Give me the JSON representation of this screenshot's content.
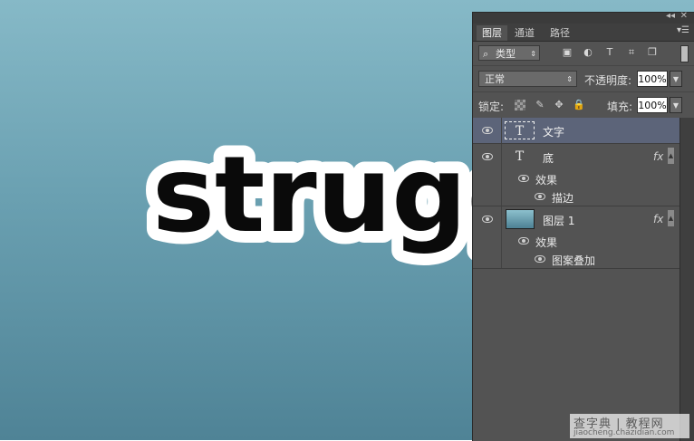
{
  "canvas": {
    "artwork_text": "struggl",
    "bg_top": "#86b9c7",
    "bg_bottom": "#4f8396"
  },
  "panel": {
    "tabs": [
      "图层",
      "通道",
      "路径"
    ],
    "active_tab": "图层",
    "filter_kind": "类型",
    "filter_icons": [
      "image-filter-icon",
      "adjustment-filter-icon",
      "type-filter-icon",
      "shape-filter-icon",
      "smart-object-filter-icon"
    ],
    "blend_mode": "正常",
    "opacity_label": "不透明度:",
    "opacity_value": "100%",
    "lock_label": "锁定:",
    "fill_label": "填充:",
    "fill_value": "100%",
    "layers": [
      {
        "name": "文字",
        "type": "text",
        "selected": true,
        "fx": ""
      },
      {
        "name": "底",
        "type": "text",
        "selected": false,
        "fx": "fx",
        "effects_label": "效果",
        "effects": [
          "描边"
        ]
      },
      {
        "name": "图层 1",
        "type": "image",
        "selected": false,
        "fx": "fx",
        "effects_label": "效果",
        "effects": [
          "图案叠加"
        ]
      }
    ],
    "selected_color": "#5c6479"
  },
  "watermark": {
    "line1": "查字典 | 教程网",
    "line2": "jiaocheng.chazidian.com"
  }
}
